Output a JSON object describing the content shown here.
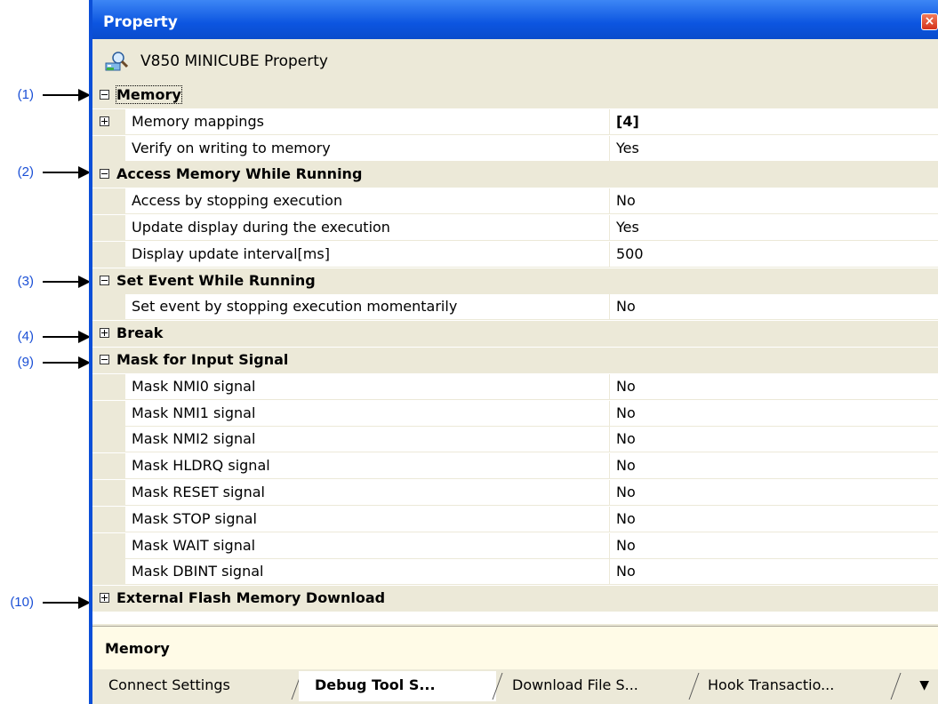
{
  "annotations": [
    "(1)",
    "(2)",
    "(3)",
    "(4)",
    "(9)",
    "(10)"
  ],
  "window": {
    "title": "Property",
    "close_glyph": "×"
  },
  "header": {
    "icon": "property-icon",
    "text": "V850 MINICUBE Property"
  },
  "rows": [
    {
      "type": "category",
      "name": "Memory",
      "expander": "minus"
    },
    {
      "type": "property",
      "name": "Memory mappings",
      "value": "[4]",
      "expander": "plus"
    },
    {
      "type": "property",
      "name": "Verify on writing to memory",
      "value": "Yes"
    },
    {
      "type": "category",
      "name": "Access Memory While Running",
      "expander": "minus"
    },
    {
      "type": "property",
      "name": "Access by stopping execution",
      "value": "No"
    },
    {
      "type": "property",
      "name": "Update display during the execution",
      "value": "Yes"
    },
    {
      "type": "property",
      "name": "Display update interval[ms]",
      "value": "500"
    },
    {
      "type": "category",
      "name": "Set Event While Running",
      "expander": "minus"
    },
    {
      "type": "property",
      "name": "Set event by stopping execution momentarily",
      "value": "No"
    },
    {
      "type": "category",
      "name": "Break",
      "expander": "plus"
    },
    {
      "type": "category",
      "name": "Mask for Input Signal",
      "expander": "minus"
    },
    {
      "type": "property",
      "name": "Mask NMI0 signal",
      "value": "No"
    },
    {
      "type": "property",
      "name": "Mask NMI1 signal",
      "value": "No"
    },
    {
      "type": "property",
      "name": "Mask NMI2 signal",
      "value": "No"
    },
    {
      "type": "property",
      "name": "Mask HLDRQ signal",
      "value": "No"
    },
    {
      "type": "property",
      "name": "Mask RESET signal",
      "value": "No"
    },
    {
      "type": "property",
      "name": "Mask STOP signal",
      "value": "No"
    },
    {
      "type": "property",
      "name": "Mask WAIT signal",
      "value": "No"
    },
    {
      "type": "property",
      "name": "Mask DBINT signal",
      "value": "No"
    },
    {
      "type": "category",
      "name": "External Flash Memory Download",
      "expander": "plus"
    }
  ],
  "description": {
    "text": "Memory"
  },
  "tabs": [
    {
      "label": "Connect Settings",
      "active": false
    },
    {
      "label": "Debug Tool S...",
      "active": true
    },
    {
      "label": "Download File S...",
      "active": false
    },
    {
      "label": "Hook Transactio...",
      "active": false
    }
  ],
  "tab_more_glyph": "▼",
  "colors": {
    "titlebar": "#0c55e0",
    "panel": "#ece9d8",
    "annotation": "#1a4fd6",
    "description_bg": "#fffbe7"
  }
}
